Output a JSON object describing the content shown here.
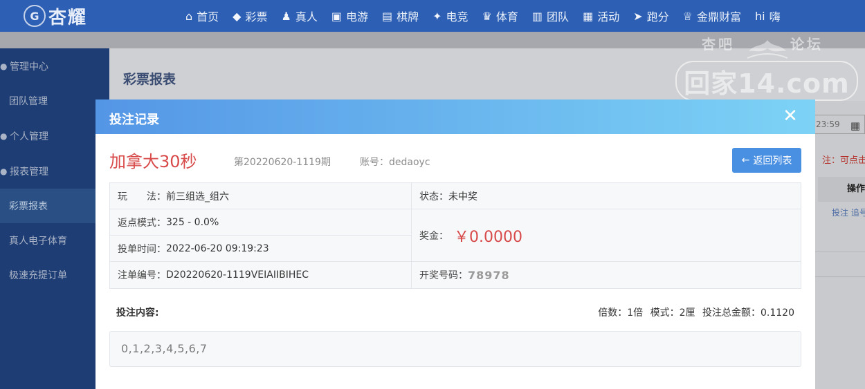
{
  "brand": {
    "emblem": "G",
    "name": "杏耀"
  },
  "nav": [
    {
      "icon": "home-icon",
      "glyph": "⌂",
      "label": "首页"
    },
    {
      "icon": "lottery-icon",
      "glyph": "◆",
      "label": "彩票"
    },
    {
      "icon": "live-icon",
      "glyph": "♟",
      "label": "真人"
    },
    {
      "icon": "slot-icon",
      "glyph": "▣",
      "label": "电游"
    },
    {
      "icon": "cards-icon",
      "glyph": "▤",
      "label": "棋牌"
    },
    {
      "icon": "gamepad-icon",
      "glyph": "✦",
      "label": "电竞"
    },
    {
      "icon": "trophy-icon",
      "glyph": "♛",
      "label": "体育"
    },
    {
      "icon": "team-icon",
      "glyph": "▥",
      "label": "团队"
    },
    {
      "icon": "gift-icon",
      "glyph": "▦",
      "label": "活动"
    },
    {
      "icon": "runner-icon",
      "glyph": "➤",
      "label": "跑分"
    },
    {
      "icon": "treasure-icon",
      "glyph": "♕",
      "label": "金鼎财富"
    },
    {
      "icon": "hi-icon",
      "glyph": "hi",
      "label": "嗨"
    }
  ],
  "sidebar": {
    "items": [
      {
        "label": "管理中心",
        "type": "group",
        "icon": "user-group-icon"
      },
      {
        "label": "团队管理",
        "type": "sub"
      },
      {
        "label": "个人管理",
        "type": "group",
        "icon": "user-icon"
      },
      {
        "label": "报表管理",
        "type": "group",
        "icon": "report-icon"
      },
      {
        "label": "彩票报表",
        "type": "sub",
        "active": true
      },
      {
        "label": "真人电子体育",
        "type": "sub"
      },
      {
        "label": "极速充提订单",
        "type": "sub"
      }
    ]
  },
  "page": {
    "title": "彩票报表",
    "date_fragment": "23:59",
    "note_fragment": "注：可点击",
    "column_fragment": "操作",
    "links_fragment": "投注  追号"
  },
  "watermark": {
    "top_left": "杏吧",
    "top_right": "论坛",
    "main": "回家14.com"
  },
  "modal": {
    "title": "投注记录",
    "close_glyph": "✕",
    "game_name": "加拿大30秒",
    "issue": "第20220620-1119期",
    "account_label": "账号：",
    "account_value": "dedaoyc",
    "back_label": "返回列表",
    "back_glyph": "←",
    "details": {
      "play_label": "玩　　法：",
      "play_value": "前三组选_组六",
      "status_label": "状态：",
      "status_value": "未中奖",
      "rebate_label": "返点模式：",
      "rebate_value": "325 - 0.0%",
      "time_label": "投单时间：",
      "time_value": "2022-06-20 09:19:23",
      "prize_label": "奖金：",
      "prize_value": "￥0.0000",
      "order_label": "注单编号：",
      "order_value": "D20220620-1119VEIAIIBIHEC",
      "draw_label": "开奖号码：",
      "draw_value": "78978"
    },
    "content_label": "投注内容:",
    "stats": {
      "multiple_label": "倍数：",
      "multiple_value": "1倍",
      "mode_label": "模式：",
      "mode_value": "2厘",
      "total_label": "投注总金额：",
      "total_value": "0.1120"
    },
    "bet_content": "0,1,2,3,4,5,6,7"
  },
  "colors": {
    "nav_bg": "#2d60b4",
    "sidebar_bg": "#1e3d74",
    "modal_header_start": "#5496e6",
    "modal_header_end": "#7dd3f6",
    "accent_red": "#d84a4a",
    "button_blue": "#4a90e2"
  }
}
